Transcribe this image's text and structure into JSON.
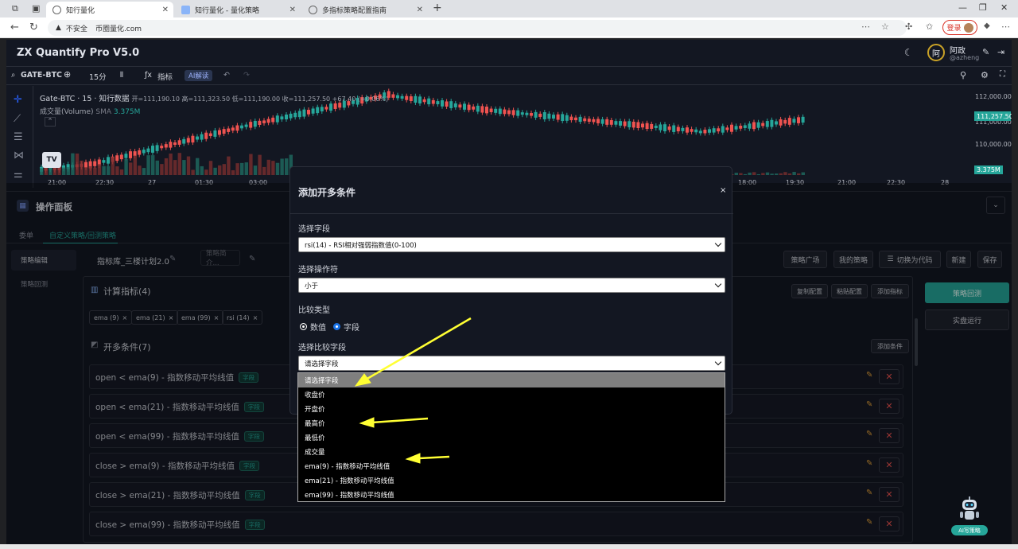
{
  "browser": {
    "tabs": [
      {
        "label": "知行量化",
        "active": true
      },
      {
        "label": "知行量化 - 量化策略",
        "active": false
      },
      {
        "label": "多指标策略配置指南",
        "active": false
      }
    ],
    "security_label": "不安全",
    "url": "币圈量化.com",
    "login_label": "登录"
  },
  "app": {
    "title": "ZX Quantify Pro V5.0",
    "user_initial": "阿",
    "user_name": "阿政",
    "user_handle": "@azheng"
  },
  "toolbar": {
    "symbol": "GATE-BTC",
    "interval": "15分",
    "indicator_label": "指标",
    "ai_label": "AI解读"
  },
  "chart": {
    "title": "Gate-BTC · 15 · 知行数据",
    "ohlc": "开=111,190.10  高=111,323.50  低=111,190.00  收=111,257.50 +67.40 (+0.06%)",
    "volume_label": "成交量(Volume)",
    "volume_ma": "SMA",
    "volume_value": "3.375M",
    "price_ticks": [
      "112,000.00",
      "111,000.00",
      "110,000.00"
    ],
    "last_price": "111,257.50",
    "volume_tag": "3.375M",
    "time_ticks": [
      "21:00",
      "22:30",
      "27",
      "01:30",
      "03:00",
      "18:00",
      "19:30",
      "21:00",
      "22:30",
      "28"
    ]
  },
  "panel": {
    "title": "操作面板",
    "subtabs": [
      "委单",
      "自定义策略/回测策略"
    ],
    "sidenav": [
      "策略编辑",
      "策略回测"
    ],
    "strategy_name": "指标库_三楼计划2.0",
    "strategy_desc_placeholder": "策略简介...",
    "top_buttons": [
      "策略广场",
      "我的策略",
      "切换为代码",
      "新建",
      "保存"
    ],
    "indicators_title": "计算指标(4)",
    "indicator_buttons": [
      "复制配置",
      "粘贴配置",
      "添加指标"
    ],
    "indicator_chips": [
      "ema (9)",
      "ema (21)",
      "ema (99)",
      "rsi (14)"
    ],
    "long_title": "开多条件(7)",
    "add_condition": "添加条件",
    "conditions": [
      {
        "text": "open  <  ema(9) - 指数移动平均线值",
        "badge": "字段"
      },
      {
        "text": "open  <  ema(21) - 指数移动平均线值",
        "badge": "字段"
      },
      {
        "text": "open  <  ema(99) - 指数移动平均线值",
        "badge": "字段"
      },
      {
        "text": "close  >  ema(9) - 指数移动平均线值",
        "badge": "字段"
      },
      {
        "text": "close  >  ema(21) - 指数移动平均线值",
        "badge": "字段"
      },
      {
        "text": "close  >  ema(99) - 指数移动平均线值",
        "badge": "字段"
      }
    ],
    "backtest_label": "策略回测",
    "live_label": "实盘运行",
    "ai_robot_label": "AI写策略"
  },
  "modal": {
    "title": "添加开多条件",
    "close": "×",
    "field_label": "选择字段",
    "field_value": "rsi(14) - RSI相对强弱指数值(0-100)",
    "operator_label": "选择操作符",
    "operator_value": "小于",
    "compare_type_label": "比较类型",
    "compare_options": [
      "数值",
      "字段"
    ],
    "compare_selected": "字段",
    "compare_field_label": "选择比较字段",
    "compare_field_value": "请选择字段",
    "dropdown_options": [
      "请选择字段",
      "收盘价",
      "开盘价",
      "最高价",
      "最低价",
      "成交量",
      "ema(9) - 指数移动平均线值",
      "ema(21) - 指数移动平均线值",
      "ema(99) - 指数移动平均线值"
    ]
  },
  "colors": {
    "up": "#26a69a",
    "down": "#ef5350",
    "annotation_arrow": "#ffff33"
  }
}
